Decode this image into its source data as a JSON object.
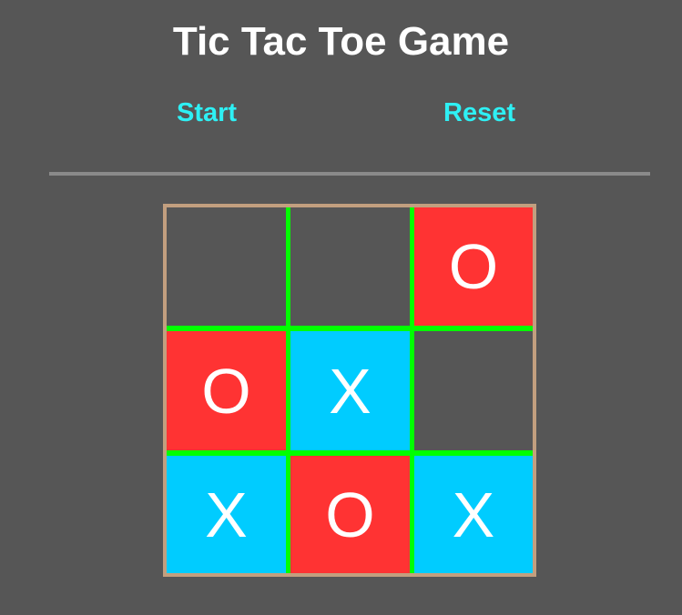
{
  "title": "Tic Tac Toe Game",
  "controls": {
    "start_label": "Start",
    "reset_label": "Reset"
  },
  "colors": {
    "background": "#565656",
    "button_text": "#2ef0f4",
    "board_border": "#c29f7f",
    "grid_lines": "#00ff00",
    "o_cell": "#ff3333",
    "x_cell": "#00ccff"
  },
  "board": {
    "cells": [
      "",
      "",
      "O",
      "O",
      "X",
      "",
      "X",
      "O",
      "X"
    ]
  }
}
